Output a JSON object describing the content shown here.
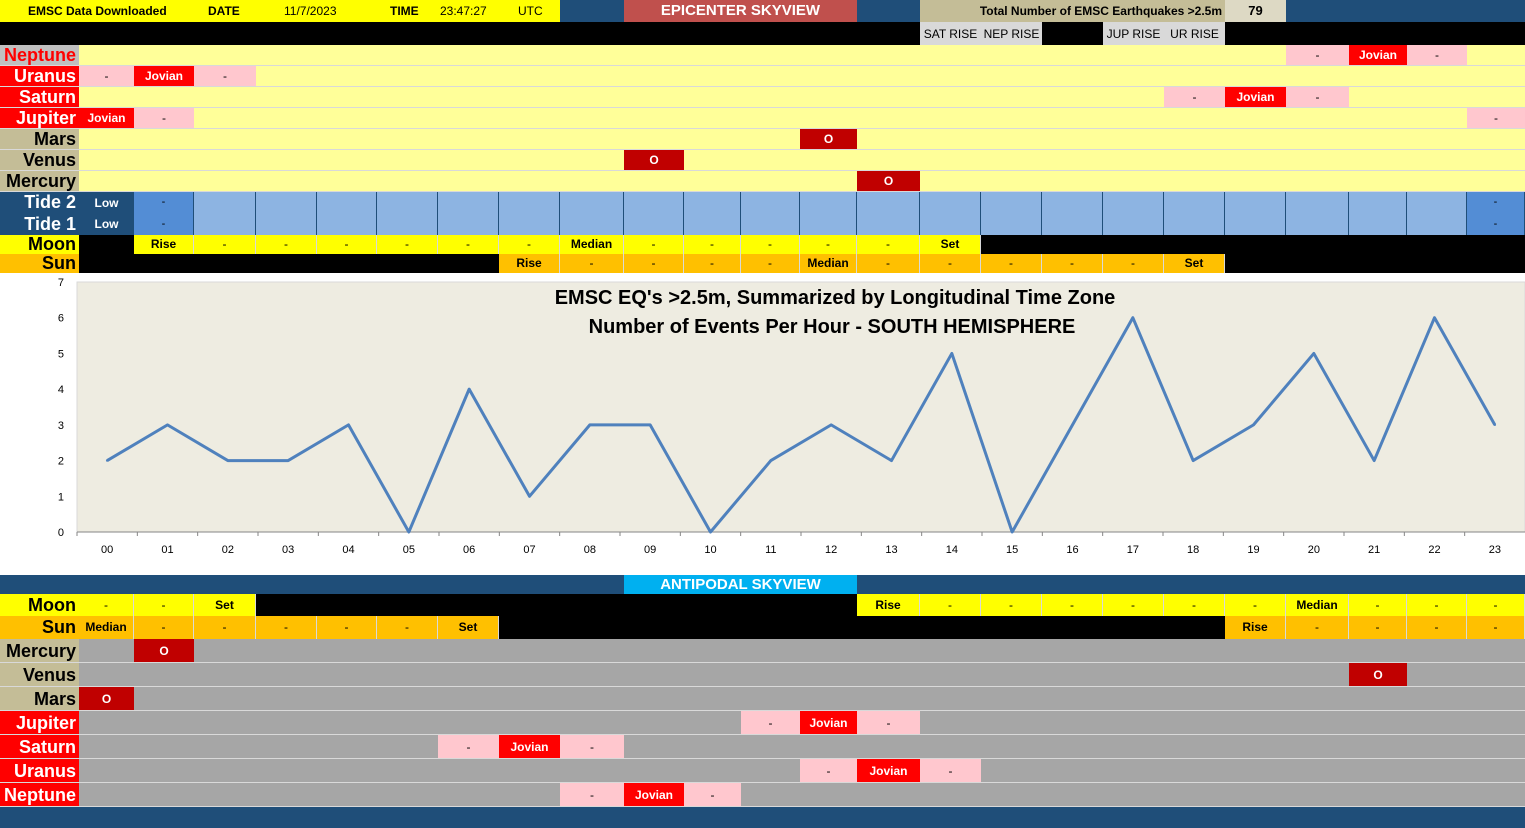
{
  "header": {
    "downloaded_label": "EMSC Data Downloaded",
    "date_label": "DATE",
    "date_value": "11/7/2023",
    "time_label": "TIME",
    "time_value": "23:47:27",
    "tz": "UTC",
    "epicenter_title": "EPICENTER SKYVIEW",
    "total_label": "Total Number of EMSC Earthquakes >2.5m",
    "total_value": "79",
    "sat_rise": "SAT RISE",
    "nep_rise": "NEP RISE",
    "jup_rise": "JUP RISE",
    "ur_rise": "UR RISE"
  },
  "hours": [
    "00",
    "01",
    "02",
    "03",
    "04",
    "05",
    "06",
    "07",
    "08",
    "09",
    "10",
    "11",
    "12",
    "13",
    "14",
    "15",
    "16",
    "17",
    "18",
    "19",
    "20",
    "21",
    "22",
    "23"
  ],
  "epicenter": {
    "planets": [
      {
        "name": "Neptune",
        "color": "#ff0000",
        "bg": "#c0c0c0",
        "cells": [
          [
            "20",
            "-",
            "pink"
          ],
          [
            "21",
            "Jovian",
            "red"
          ],
          [
            "22",
            "-",
            "pink"
          ]
        ]
      },
      {
        "name": "Uranus",
        "color": "#ffffff",
        "bg": "#ff0000",
        "cells": [
          [
            "00",
            "-",
            "pink"
          ],
          [
            "01",
            "Jovian",
            "red"
          ],
          [
            "02",
            "-",
            "pink"
          ]
        ]
      },
      {
        "name": "Saturn",
        "color": "#ffffff",
        "bg": "#ff0000",
        "cells": [
          [
            "18",
            "-",
            "pink"
          ],
          [
            "19",
            "Jovian",
            "red"
          ],
          [
            "20",
            "-",
            "pink"
          ]
        ]
      },
      {
        "name": "Jupiter",
        "color": "#ffffff",
        "bg": "#ff0000",
        "cells": [
          [
            "00",
            "Jovian",
            "red"
          ],
          [
            "01",
            "-",
            "pink"
          ],
          [
            "23",
            "-",
            "pink"
          ]
        ]
      },
      {
        "name": "Mars",
        "color": "#000000",
        "bg": "#c4bd97",
        "cells": [
          [
            "12",
            "O",
            "red"
          ]
        ]
      },
      {
        "name": "Venus",
        "color": "#000000",
        "bg": "#c4bd97",
        "cells": [
          [
            "09",
            "O",
            "red"
          ]
        ]
      },
      {
        "name": "Mercury",
        "color": "#000000",
        "bg": "#c4bd97",
        "cells": [
          [
            "13",
            "O",
            "red"
          ]
        ]
      }
    ],
    "tide2_label": "Tide 2",
    "tide1_label": "Tide 1",
    "tide2_low": "Low",
    "tide1_low": "Low",
    "tide_dash": "-",
    "moon_label": "Moon",
    "moon": [
      "",
      "Rise",
      "-",
      "-",
      "-",
      "-",
      "-",
      "-",
      "Median",
      "-",
      "-",
      "-",
      "-",
      "-",
      "Set",
      "",
      "",
      "",
      "",
      "",
      "",
      "",
      "",
      ""
    ],
    "sun_label": "Sun",
    "sun": [
      "",
      "",
      "",
      "",
      "",
      "",
      "",
      "Rise",
      "-",
      "-",
      "-",
      "-",
      "Median",
      "-",
      "-",
      "-",
      "-",
      "-",
      "Set",
      "",
      "",
      "",
      "",
      ""
    ]
  },
  "antipodal": {
    "title": "ANTIPODAL SKYVIEW",
    "moon_label": "Moon",
    "moon": [
      "-",
      "-",
      "Set",
      "",
      "",
      "",
      "",
      "",
      "",
      "",
      "",
      "",
      "",
      "Rise",
      "-",
      "-",
      "-",
      "-",
      "-",
      "-",
      "Median",
      "-",
      "-",
      "-"
    ],
    "sun_label": "Sun",
    "sun": [
      "Median",
      "-",
      "-",
      "-",
      "-",
      "-",
      "Set",
      "",
      "",
      "",
      "",
      "",
      "",
      "",
      "",
      "",
      "",
      "",
      "",
      "Rise",
      "-",
      "-",
      "-",
      "-"
    ],
    "planets": [
      {
        "name": "Mercury",
        "color": "#000000",
        "bg": "#c4bd97",
        "cells": [
          [
            "01",
            "O",
            "red"
          ]
        ]
      },
      {
        "name": "Venus",
        "color": "#000000",
        "bg": "#c4bd97",
        "cells": [
          [
            "21",
            "O",
            "red"
          ]
        ]
      },
      {
        "name": "Mars",
        "color": "#000000",
        "bg": "#c4bd97",
        "cells": [
          [
            "00",
            "O",
            "red"
          ]
        ]
      },
      {
        "name": "Jupiter",
        "color": "#ffffff",
        "bg": "#ff0000",
        "cells": [
          [
            "11",
            "-",
            "pink"
          ],
          [
            "12",
            "Jovian",
            "red"
          ],
          [
            "13",
            "-",
            "pink"
          ]
        ]
      },
      {
        "name": "Saturn",
        "color": "#ffffff",
        "bg": "#ff0000",
        "cells": [
          [
            "06",
            "-",
            "pink"
          ],
          [
            "07",
            "Jovian",
            "red"
          ],
          [
            "08",
            "-",
            "pink"
          ]
        ]
      },
      {
        "name": "Uranus",
        "color": "#ffffff",
        "bg": "#ff0000",
        "cells": [
          [
            "12",
            "-",
            "pink"
          ],
          [
            "13",
            "Jovian",
            "red"
          ],
          [
            "14",
            "-",
            "pink"
          ]
        ]
      },
      {
        "name": "Neptune",
        "color": "#ffffff",
        "bg": "#ff0000",
        "cells": [
          [
            "08",
            "-",
            "pink"
          ],
          [
            "09",
            "Jovian",
            "red"
          ],
          [
            "10",
            "-",
            "pink"
          ]
        ]
      }
    ]
  },
  "colors": {
    "planet_row_top": "#ffff99",
    "planet_row_bottom": "#a6a6a6",
    "jovian_red": "#ff0000",
    "marker_red": "#c00000",
    "pink": "#ffc7ce",
    "tide": "#8db4e2",
    "tide_dark": "#538dd5",
    "moon_yellow": "#ffff00",
    "sun_orange": "#ffc000",
    "chart_bg": "#eeece1",
    "line": "#4f81bd",
    "navy": "#1f4e79",
    "title_red": "#c0504d",
    "antipodal_cyan": "#00b0f0"
  },
  "chart_data": {
    "type": "line",
    "title": "EMSC EQ's >2.5m, Summarized by Longitudinal Time Zone",
    "subtitle": "Number of Events Per Hour - SOUTH HEMISPHERE",
    "categories": [
      "00",
      "01",
      "02",
      "03",
      "04",
      "05",
      "06",
      "07",
      "08",
      "09",
      "10",
      "11",
      "12",
      "13",
      "14",
      "15",
      "16",
      "17",
      "18",
      "19",
      "20",
      "21",
      "22",
      "23"
    ],
    "values": [
      2,
      3,
      2,
      2,
      3,
      0,
      4,
      1,
      3,
      3,
      0,
      2,
      3,
      2,
      5,
      0,
      3,
      6,
      2,
      3,
      5,
      2,
      6,
      3
    ],
    "ylim": [
      0,
      7
    ],
    "yticks": [
      "0",
      "1",
      "2",
      "3",
      "4",
      "5",
      "6",
      "7"
    ],
    "grid": false
  }
}
